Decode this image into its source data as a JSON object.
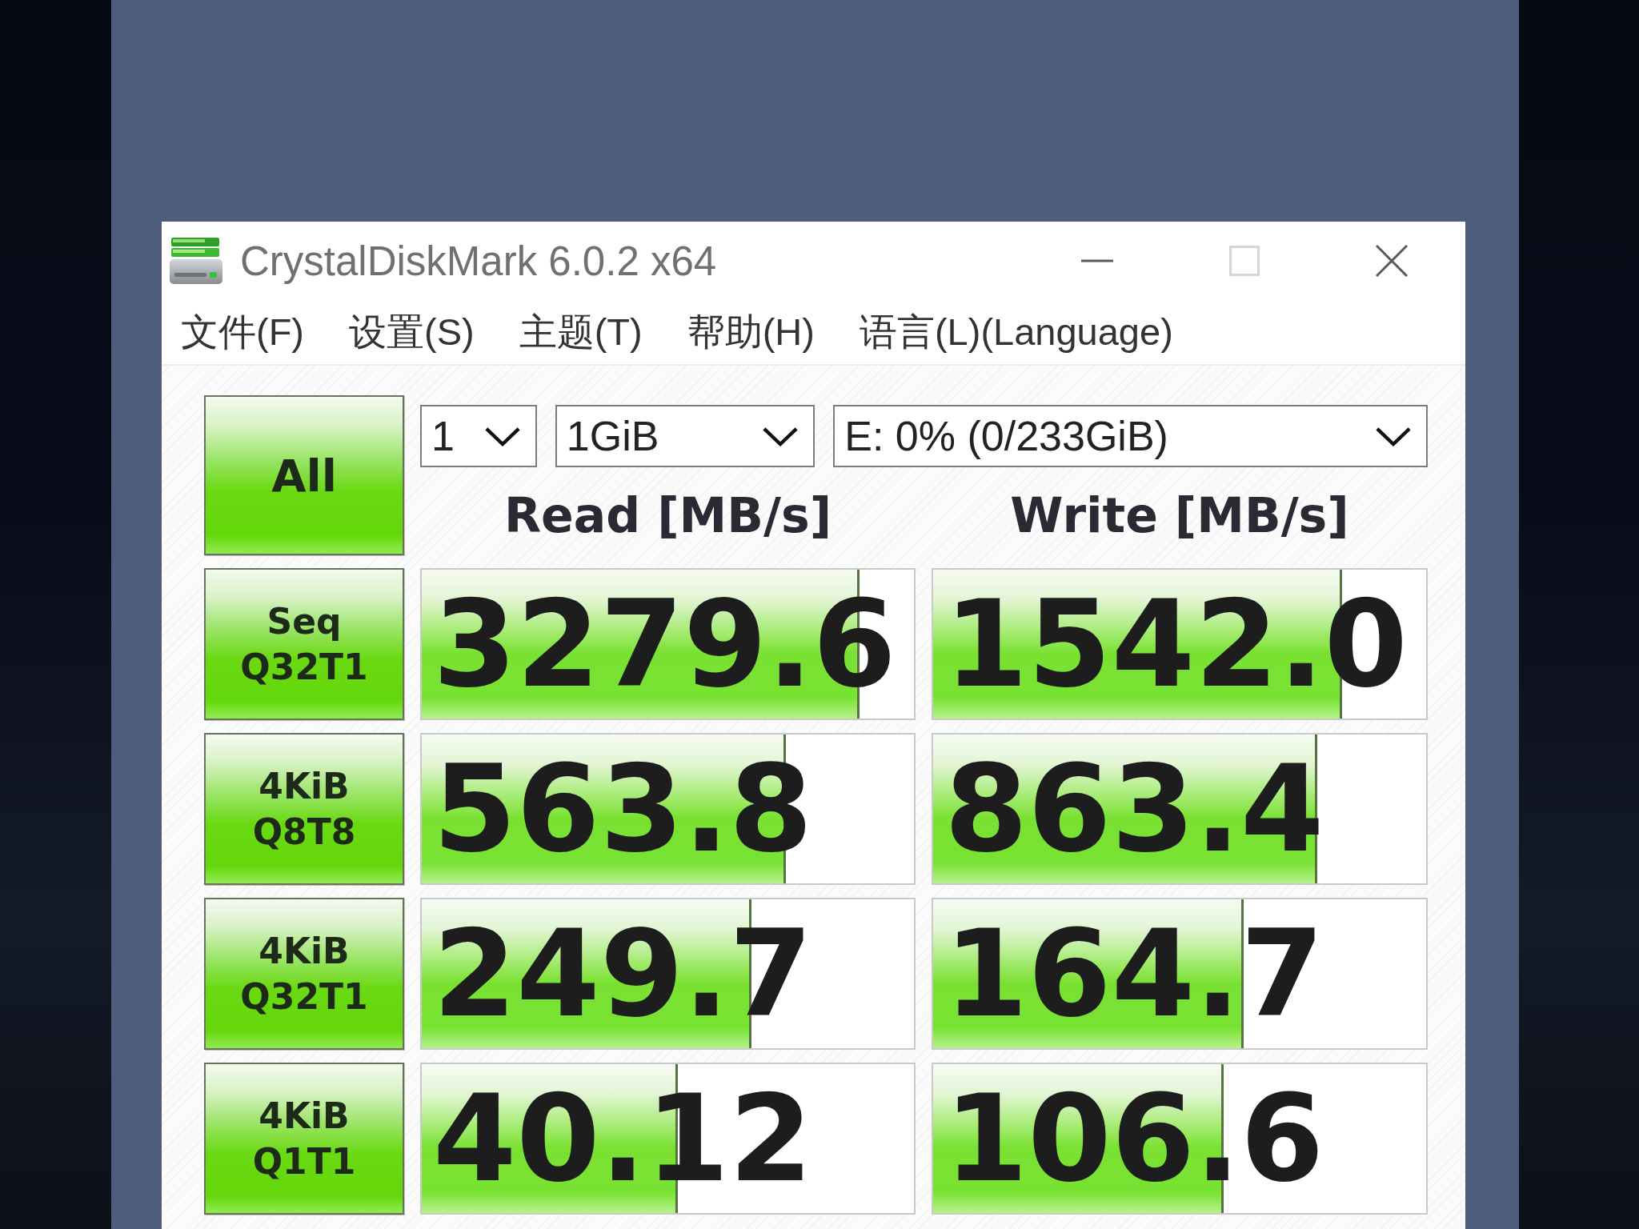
{
  "window": {
    "title": "CrystalDiskMark 6.0.2 x64",
    "buttons": [
      {
        "kind": "minimize",
        "disabled": false
      },
      {
        "kind": "maximize",
        "disabled": true
      },
      {
        "kind": "close",
        "disabled": false
      }
    ]
  },
  "menu": [
    "文件(F)",
    "设置(S)",
    "主题(T)",
    "帮助(H)",
    "语言(L)(Language)"
  ],
  "controls": {
    "all_button": "All",
    "dropdowns": [
      "1",
      "1GiB",
      "E: 0% (0/233GiB)"
    ]
  },
  "columns": [
    "Read [MB/s]",
    "Write [MB/s]"
  ],
  "tests": [
    {
      "label_lines": [
        "Seq",
        "Q32T1"
      ],
      "read": {
        "value": "3279.6",
        "level": 0.89
      },
      "write": {
        "value": "1542.0",
        "level": 0.83
      }
    },
    {
      "label_lines": [
        "4KiB",
        "Q8T8"
      ],
      "read": {
        "value": "563.8",
        "level": 0.74
      },
      "write": {
        "value": "863.4",
        "level": 0.78
      }
    },
    {
      "label_lines": [
        "4KiB",
        "Q32T1"
      ],
      "read": {
        "value": "249.7",
        "level": 0.67
      },
      "write": {
        "value": "164.7",
        "level": 0.63
      }
    },
    {
      "label_lines": [
        "4KiB",
        "Q1T1"
      ],
      "read": {
        "value": "40.12",
        "level": 0.52
      },
      "write": {
        "value": "106.6",
        "level": 0.59
      }
    }
  ]
}
